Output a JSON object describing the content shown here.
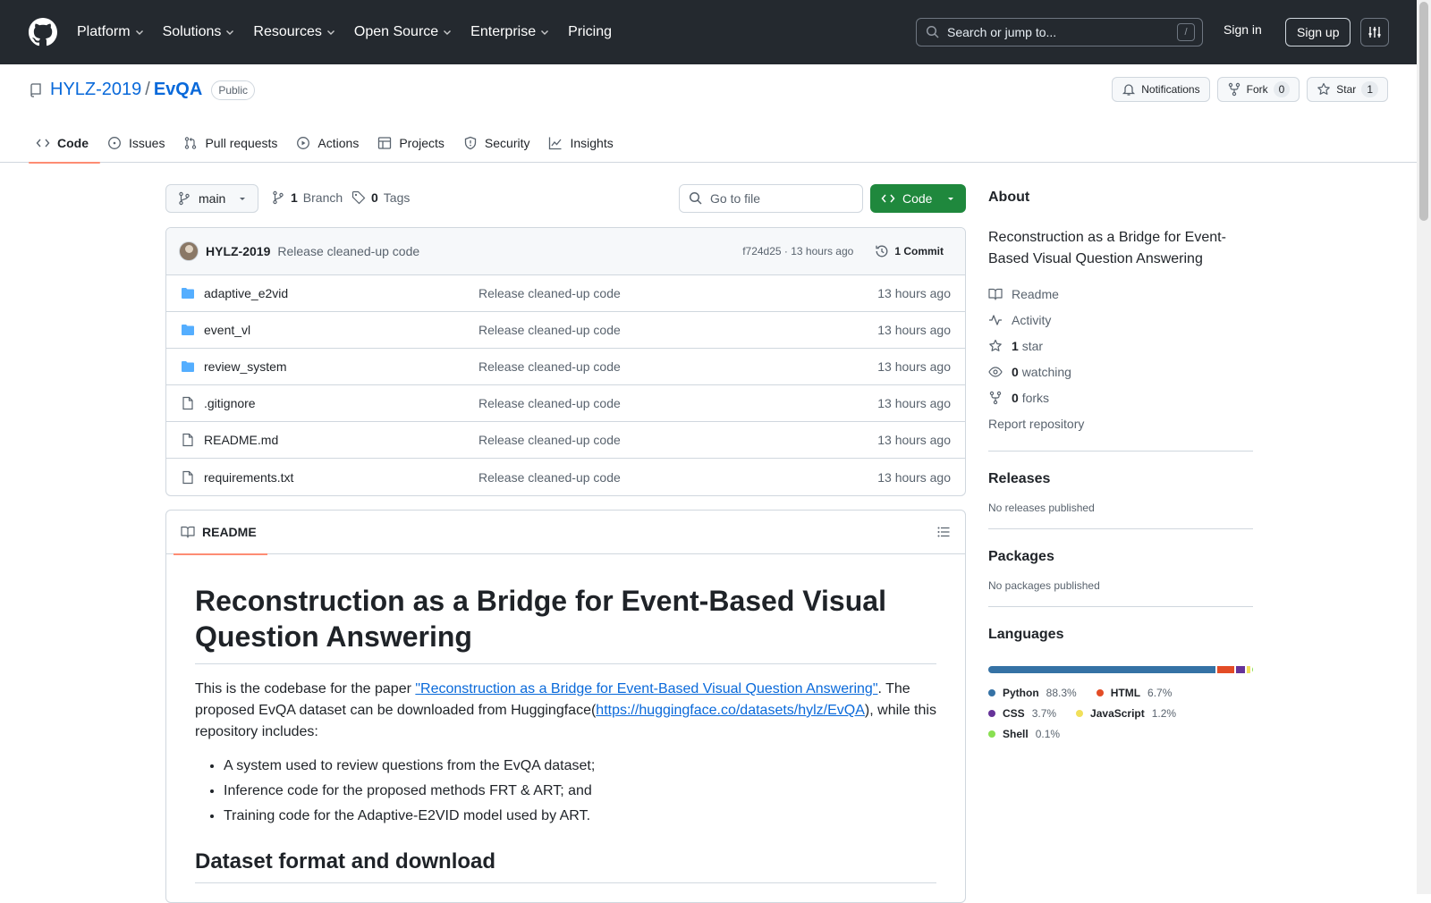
{
  "header": {
    "nav": [
      "Platform",
      "Solutions",
      "Resources",
      "Open Source",
      "Enterprise",
      "Pricing"
    ],
    "search_placeholder": "Search or jump to...",
    "search_shortcut": "/",
    "signin": "Sign in",
    "signup": "Sign up"
  },
  "repo": {
    "owner": "HYLZ-2019",
    "separator": "/",
    "name": "EvQA",
    "visibility": "Public",
    "notifications": "Notifications",
    "fork_label": "Fork",
    "fork_count": "0",
    "star_label": "Star",
    "star_count": "1"
  },
  "tabs": [
    "Code",
    "Issues",
    "Pull requests",
    "Actions",
    "Projects",
    "Security",
    "Insights"
  ],
  "toolbar": {
    "branch": "main",
    "branches_count": "1",
    "branches_label": "Branch",
    "tags_count": "0",
    "tags_label": "Tags",
    "goto_placeholder": "Go to file",
    "code_button": "Code"
  },
  "commit": {
    "author": "HYLZ-2019",
    "message": "Release cleaned-up code",
    "hash_time": "f724d25 · 13 hours ago",
    "count": "1 Commit"
  },
  "files": [
    {
      "name": "adaptive_e2vid",
      "type": "folder",
      "message": "Release cleaned-up code",
      "time": "13 hours ago"
    },
    {
      "name": "event_vl",
      "type": "folder",
      "message": "Release cleaned-up code",
      "time": "13 hours ago"
    },
    {
      "name": "review_system",
      "type": "folder",
      "message": "Release cleaned-up code",
      "time": "13 hours ago"
    },
    {
      "name": ".gitignore",
      "type": "file",
      "message": "Release cleaned-up code",
      "time": "13 hours ago"
    },
    {
      "name": "README.md",
      "type": "file",
      "message": "Release cleaned-up code",
      "time": "13 hours ago"
    },
    {
      "name": "requirements.txt",
      "type": "file",
      "message": "Release cleaned-up code",
      "time": "13 hours ago"
    }
  ],
  "readme": {
    "tab_label": "README",
    "title": "Reconstruction as a Bridge for Event-Based Visual Question Answering",
    "p1_before": "This is the codebase for the paper ",
    "p1_link": "\"Reconstruction as a Bridge for Event-Based Visual Question Answering\"",
    "p1_middle": ". The proposed EvQA dataset can be downloaded from Huggingface(",
    "p1_link2": "https://huggingface.co/datasets/hylz/EvQA",
    "p1_after": "), while this repository includes:",
    "bullets": [
      "A system used to review questions from the EvQA dataset;",
      "Inference code for the proposed methods FRT & ART; and",
      "Training code for the Adaptive-E2VID model used by ART."
    ],
    "h2": "Dataset format and download"
  },
  "about": {
    "heading": "About",
    "description": "Reconstruction as a Bridge for Event-Based Visual Question Answering",
    "readme": "Readme",
    "activity": "Activity",
    "stars_count": "1",
    "stars_label": "star",
    "watching_count": "0",
    "watching_label": "watching",
    "forks_count": "0",
    "forks_label": "forks",
    "report": "Report repository"
  },
  "releases": {
    "heading": "Releases",
    "empty": "No releases published"
  },
  "packages": {
    "heading": "Packages",
    "empty": "No packages published"
  },
  "languages": {
    "heading": "Languages",
    "items": [
      {
        "name": "Python",
        "percent": "88.3%",
        "value": 88.3,
        "color": "#3572A5"
      },
      {
        "name": "HTML",
        "percent": "6.7%",
        "value": 6.7,
        "color": "#e34c26"
      },
      {
        "name": "CSS",
        "percent": "3.7%",
        "value": 3.7,
        "color": "#663399"
      },
      {
        "name": "JavaScript",
        "percent": "1.2%",
        "value": 1.2,
        "color": "#f1e05a"
      },
      {
        "name": "Shell",
        "percent": "0.1%",
        "value": 0.1,
        "color": "#89e051"
      }
    ]
  }
}
